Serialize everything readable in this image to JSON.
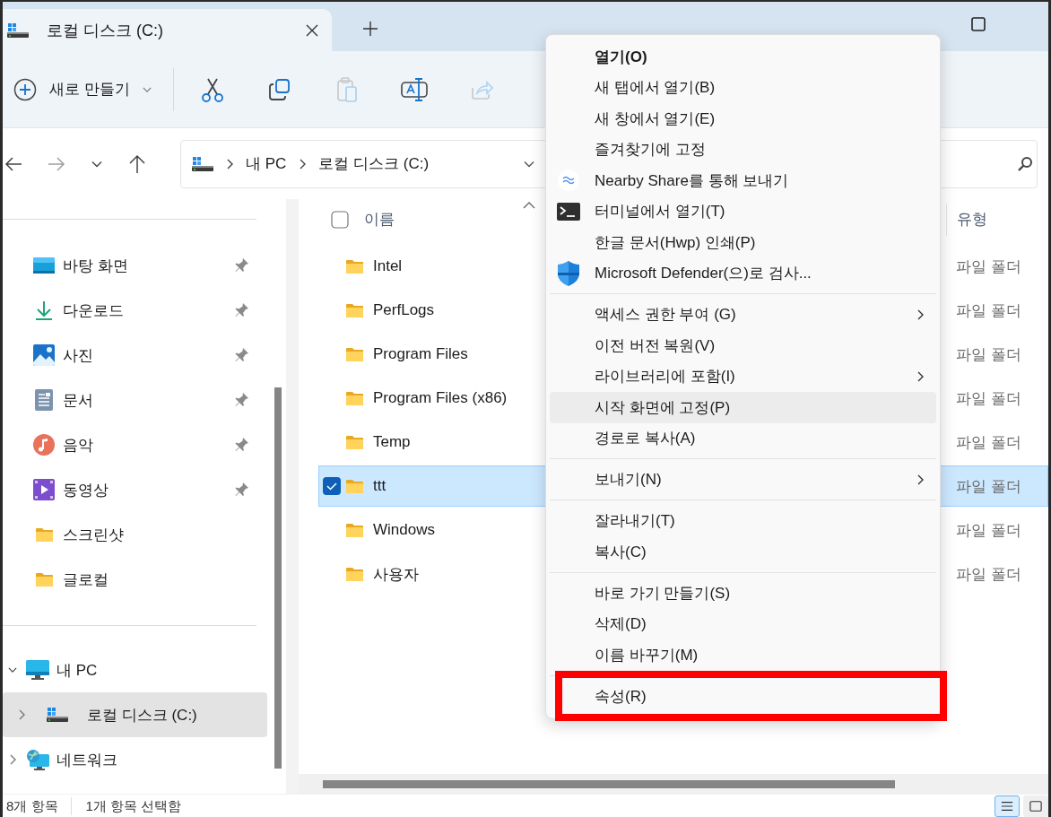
{
  "tab": {
    "title": "로컬 디스크 (C:)",
    "selected": true
  },
  "toolbar": {
    "new_button": {
      "label": "새로 만들기"
    },
    "actions": [
      {
        "kind": "cut",
        "disabled": false
      },
      {
        "kind": "copy",
        "disabled": false
      },
      {
        "kind": "paste",
        "disabled": true
      },
      {
        "kind": "rename",
        "disabled": false
      },
      {
        "kind": "share",
        "disabled": true
      }
    ]
  },
  "navigation": {
    "back": {
      "disabled": false
    },
    "forward": {
      "disabled": true
    }
  },
  "address": {
    "breadcrumb": [
      "내 PC",
      "로컬 디스크 (C:)"
    ]
  },
  "sidebar": {
    "quick_access": [
      {
        "label": "바탕 화면",
        "kind": "desktop",
        "pinned": true
      },
      {
        "label": "다운로드",
        "kind": "download",
        "pinned": true
      },
      {
        "label": "사진",
        "kind": "photo",
        "pinned": true
      },
      {
        "label": "문서",
        "kind": "document",
        "pinned": true
      },
      {
        "label": "음악",
        "kind": "music",
        "pinned": true
      },
      {
        "label": "동영상",
        "kind": "video",
        "pinned": true
      },
      {
        "label": "스크린샷",
        "kind": "folder",
        "pinned": false
      },
      {
        "label": "글로컬",
        "kind": "folder",
        "pinned": false
      }
    ],
    "tree": [
      {
        "label": "내 PC",
        "kind": "pc",
        "expanded": true,
        "selected": false,
        "children": [
          {
            "label": "로컬 디스크 (C:)",
            "kind": "drive",
            "expanded": false,
            "selected": true
          }
        ]
      },
      {
        "label": "네트워크",
        "kind": "network",
        "expanded": false,
        "selected": false
      }
    ]
  },
  "file_list": {
    "columns": [
      "이름",
      "유형"
    ],
    "select_all": {
      "checked": false
    },
    "rows": [
      {
        "name": "Intel",
        "type": "파일 폴더",
        "selected": false
      },
      {
        "name": "PerfLogs",
        "type": "파일 폴더",
        "selected": false
      },
      {
        "name": "Program Files",
        "type": "파일 폴더",
        "selected": false
      },
      {
        "name": "Program Files (x86)",
        "type": "파일 폴더",
        "selected": false
      },
      {
        "name": "Temp",
        "type": "파일 폴더",
        "selected": false
      },
      {
        "name": "ttt",
        "type": "파일 폴더",
        "selected": true
      },
      {
        "name": "Windows",
        "type": "파일 폴더",
        "selected": false
      },
      {
        "name": "사용자",
        "type": "파일 폴더",
        "selected": false
      }
    ]
  },
  "context_menu": {
    "items": [
      {
        "kind": "plain",
        "label": "열기(O)",
        "default": true,
        "submenu": false,
        "selected": false,
        "highlighted": false
      },
      {
        "kind": "plain",
        "label": "새 탭에서 열기(B)",
        "default": false,
        "submenu": false,
        "selected": false,
        "highlighted": false
      },
      {
        "kind": "plain",
        "label": "새 창에서 열기(E)",
        "default": false,
        "submenu": false,
        "selected": false,
        "highlighted": false
      },
      {
        "kind": "plain",
        "label": "즐겨찾기에 고정",
        "default": false,
        "submenu": false,
        "selected": false,
        "highlighted": false
      },
      {
        "kind": "share",
        "label": "Nearby Share를 통해 보내기",
        "default": false,
        "submenu": false,
        "selected": false,
        "highlighted": false
      },
      {
        "kind": "terminal",
        "label": "터미널에서 열기(T)",
        "default": false,
        "submenu": false,
        "selected": false,
        "highlighted": false
      },
      {
        "kind": "plain",
        "label": "한글 문서(Hwp) 인쇄(P)",
        "default": false,
        "submenu": false,
        "selected": false,
        "highlighted": false
      },
      {
        "kind": "shield",
        "label": "Microsoft Defender(으)로 검사...",
        "default": false,
        "submenu": false,
        "selected": false,
        "highlighted": false
      },
      {
        "kind": "separator"
      },
      {
        "kind": "plain",
        "label": "액세스 권한 부여 (G)",
        "default": false,
        "submenu": true,
        "selected": false,
        "highlighted": false
      },
      {
        "kind": "plain",
        "label": "이전 버전 복원(V)",
        "default": false,
        "submenu": false,
        "selected": false,
        "highlighted": false
      },
      {
        "kind": "plain",
        "label": "라이브러리에 포함(I)",
        "default": false,
        "submenu": true,
        "selected": false,
        "highlighted": false
      },
      {
        "kind": "plain",
        "label": "시작 화면에 고정(P)",
        "default": false,
        "submenu": false,
        "selected": true,
        "highlighted": false
      },
      {
        "kind": "plain",
        "label": "경로로 복사(A)",
        "default": false,
        "submenu": false,
        "selected": false,
        "highlighted": false
      },
      {
        "kind": "separator"
      },
      {
        "kind": "plain",
        "label": "보내기(N)",
        "default": false,
        "submenu": true,
        "selected": false,
        "highlighted": false
      },
      {
        "kind": "separator"
      },
      {
        "kind": "plain",
        "label": "잘라내기(T)",
        "default": false,
        "submenu": false,
        "selected": false,
        "highlighted": false
      },
      {
        "kind": "plain",
        "label": "복사(C)",
        "default": false,
        "submenu": false,
        "selected": false,
        "highlighted": false
      },
      {
        "kind": "separator"
      },
      {
        "kind": "plain",
        "label": "바로 가기 만들기(S)",
        "default": false,
        "submenu": false,
        "selected": false,
        "highlighted": false
      },
      {
        "kind": "plain",
        "label": "삭제(D)",
        "default": false,
        "submenu": false,
        "selected": false,
        "highlighted": false
      },
      {
        "kind": "plain",
        "label": "이름 바꾸기(M)",
        "default": false,
        "submenu": false,
        "selected": false,
        "highlighted": false
      },
      {
        "kind": "separator"
      },
      {
        "kind": "plain",
        "label": "속성(R)",
        "default": false,
        "submenu": false,
        "selected": false,
        "highlighted": true
      }
    ]
  },
  "status_bar": {
    "item_count": "8개 항목",
    "selection": "1개 항목 선택함",
    "view_modes": [
      {
        "kind": "details",
        "selected": true
      },
      {
        "kind": "tiles",
        "selected": false
      }
    ]
  }
}
